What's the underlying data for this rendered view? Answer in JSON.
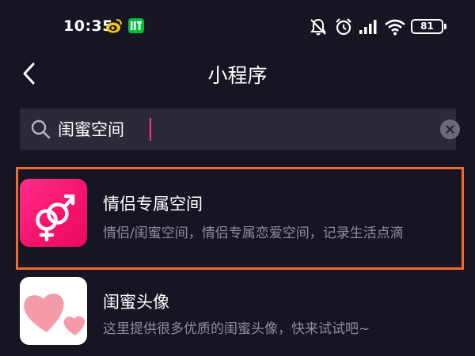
{
  "status_bar": {
    "time": "10:35",
    "battery": "81",
    "icons": [
      "weibo-icon",
      "iqiyi-icon",
      "mute-icon",
      "alarm-icon",
      "signal-icon",
      "wifi-icon",
      "battery-icon"
    ]
  },
  "nav": {
    "title": "小程序"
  },
  "search": {
    "value": "闺蜜空间"
  },
  "results": [
    {
      "title": "情侣专属空间",
      "description": "情侣/闺蜜空间，情侣专属恋爱空间，记录生活点滴",
      "icon": "couple-symbol-icon",
      "highlight_color": "#f06a32"
    },
    {
      "title": "闺蜜头像",
      "description": "这里提供很多优质的闺蜜头像，快来试试吧~",
      "icon": "hearts-icon"
    }
  ],
  "colors": {
    "background": "#161622",
    "search_bg": "#2a2a38",
    "accent": "#ff2f6d",
    "secondary_text": "#8d8d99"
  }
}
